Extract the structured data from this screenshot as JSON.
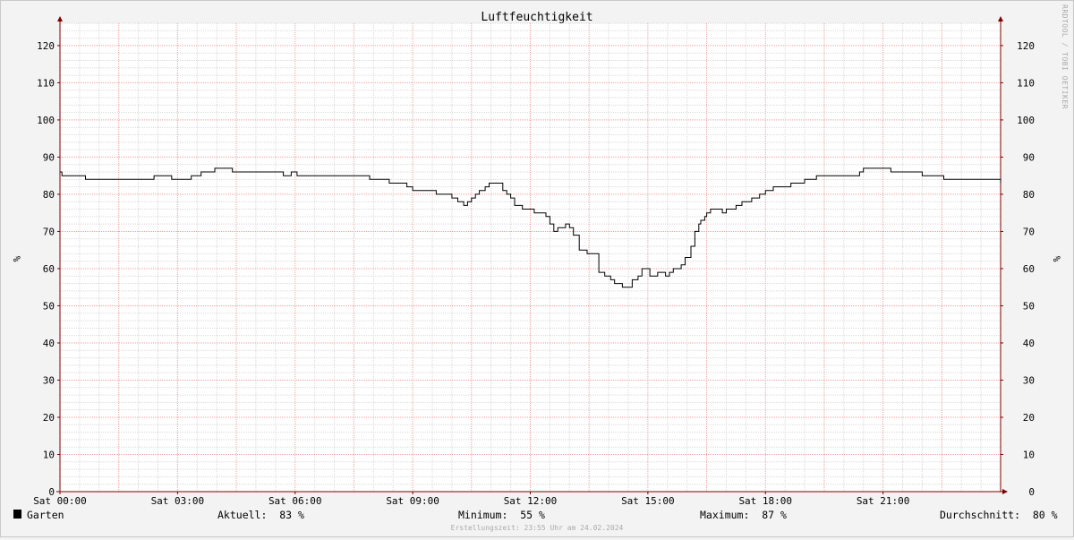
{
  "chart_data": {
    "type": "line",
    "title": "Luftfeuchtigkeit",
    "ylabel": "%",
    "ylim": [
      0,
      126
    ],
    "yticks": [
      0,
      10,
      20,
      30,
      40,
      50,
      60,
      70,
      80,
      90,
      100,
      110,
      120
    ],
    "xlim": [
      0,
      24
    ],
    "xticks": [
      {
        "x": 0,
        "label": "Sat 00:00"
      },
      {
        "x": 3,
        "label": "Sat 03:00"
      },
      {
        "x": 6,
        "label": "Sat 06:00"
      },
      {
        "x": 9,
        "label": "Sat 09:00"
      },
      {
        "x": 12,
        "label": "Sat 12:00"
      },
      {
        "x": 15,
        "label": "Sat 15:00"
      },
      {
        "x": 18,
        "label": "Sat 18:00"
      },
      {
        "x": 21,
        "label": "Sat 21:00"
      }
    ],
    "grid": true,
    "series": [
      {
        "name": "Garten",
        "color": "#000000",
        "step": true,
        "x": [
          0,
          0.05,
          0.65,
          2.4,
          2.85,
          3.35,
          3.6,
          3.95,
          4.4,
          4.95,
          5.7,
          5.9,
          6.05,
          6.2,
          7.9,
          8.3,
          8.4,
          8.85,
          9.0,
          9.6,
          10.0,
          10.15,
          10.3,
          10.4,
          10.5,
          10.6,
          10.7,
          10.85,
          10.95,
          11.0,
          11.3,
          11.4,
          11.5,
          11.6,
          11.8,
          12.1,
          12.3,
          12.4,
          12.5,
          12.6,
          12.7,
          12.9,
          13.0,
          13.1,
          13.25,
          13.45,
          13.6,
          13.75,
          13.9,
          14.05,
          14.15,
          14.35,
          14.6,
          14.75,
          14.85,
          14.95,
          15.05,
          15.15,
          15.25,
          15.45,
          15.55,
          15.65,
          15.75,
          15.85,
          15.95,
          16.1,
          16.2,
          16.3,
          16.35,
          16.45,
          16.5,
          16.55,
          16.6,
          16.7,
          16.8,
          16.9,
          17.0,
          17.1,
          17.25,
          17.4,
          17.65,
          17.85,
          18.0,
          18.2,
          18.65,
          19.0,
          19.3,
          20.4,
          20.5,
          21.2,
          22.0,
          22.55,
          24.0
        ],
        "values": [
          86,
          85,
          84,
          85,
          84,
          85,
          86,
          87,
          86,
          86,
          85,
          86,
          85,
          85,
          84,
          84,
          83,
          82,
          81,
          80,
          79,
          78,
          77,
          78,
          79,
          80,
          81,
          82,
          83,
          83,
          81,
          80,
          79,
          77,
          76,
          75,
          75,
          74,
          72,
          70,
          71,
          72,
          71,
          69,
          65,
          64,
          64,
          59,
          58,
          57,
          56,
          55,
          57,
          58,
          60,
          60,
          58,
          58,
          59,
          58,
          59,
          60,
          60,
          61,
          63,
          66,
          70,
          72,
          73,
          74,
          75,
          75,
          76,
          76,
          76,
          75,
          76,
          76,
          77,
          78,
          79,
          80,
          81,
          82,
          83,
          84,
          85,
          86,
          87,
          86,
          85,
          84,
          83
        ]
      }
    ]
  },
  "legend": {
    "series_name": "Garten",
    "swatch_color": "#000000",
    "aktuell": "Aktuell:  83 %",
    "minimum": "Minimum:  55 %",
    "maximum": "Maximum:  87 %",
    "durchschnitt": "Durchschnitt:  80 %"
  },
  "footer": "Erstellungszeit: 23:55 Uhr am 24.02.2024",
  "watermark": "RRDTOOL / TOBI OETIKER",
  "colors": {
    "background": "#f3f3f3",
    "plot_background": "#ffffff",
    "minor_grid": "#d9d9d9",
    "major_grid": "#f0a0a0",
    "axis": "#800000",
    "line": "#000000"
  }
}
